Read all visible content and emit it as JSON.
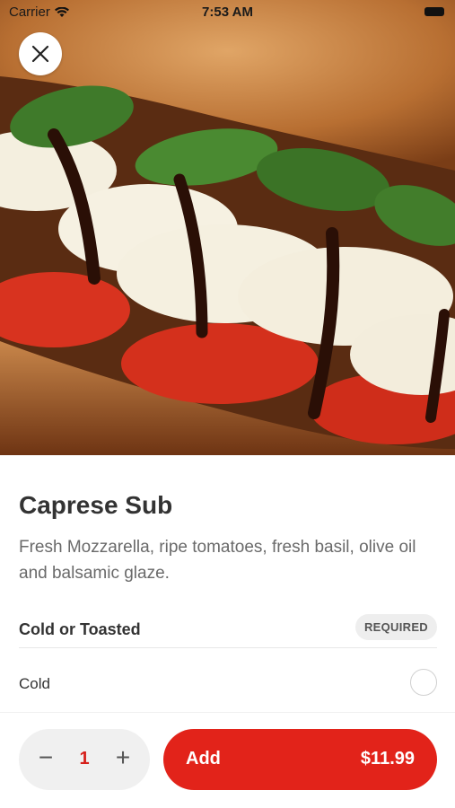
{
  "status_bar": {
    "carrier": "Carrier",
    "time": "7:53 AM"
  },
  "hero": {
    "image_subject": "caprese-sandwich-photo"
  },
  "item": {
    "title": "Caprese Sub",
    "description": "Fresh Mozzarella, ripe tomatoes, fresh basil, olive oil and balsamic glaze."
  },
  "options": {
    "group_title": "Cold or Toasted",
    "badge": "REQUIRED",
    "choices": [
      {
        "label": "Cold",
        "selected": false
      }
    ]
  },
  "footer": {
    "quantity": "1",
    "minus": "−",
    "plus": "+",
    "add_label": "Add",
    "price": "$11.99"
  },
  "colors": {
    "accent": "#e2231a",
    "quantity_text": "#d6201a",
    "pill_bg": "#f0f0f0"
  },
  "icons": [
    "close-icon",
    "wifi-icon",
    "battery-icon",
    "minus-icon",
    "plus-icon"
  ]
}
